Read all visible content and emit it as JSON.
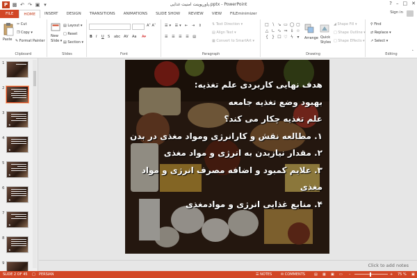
{
  "window": {
    "title": "پاورپوینت امنیت غذایی.pptx - PowerPoint",
    "sign_in": "Sign in",
    "controls": [
      "?",
      "–",
      "□",
      "✕"
    ]
  },
  "tabs": [
    "FILE",
    "HOME",
    "INSERT",
    "DESIGN",
    "TRANSITIONS",
    "ANIMATIONS",
    "SLIDE SHOW",
    "REVIEW",
    "VIEW",
    "FILEminimizer"
  ],
  "ribbon": {
    "clipboard": {
      "label": "Clipboard",
      "paste": "Paste",
      "cut": "Cut",
      "copy": "Copy",
      "format_painter": "Format Painter"
    },
    "slides": {
      "label": "Slides",
      "new_slide": "New",
      "new_slide_2": "Slide",
      "layout": "Layout",
      "reset": "Reset",
      "section": "Section"
    },
    "font": {
      "label": "Font",
      "bold": "B",
      "italic": "I",
      "underline": "U",
      "strike": "S",
      "shadow": "abc",
      "spacing": "AV",
      "case": "Aa"
    },
    "paragraph": {
      "label": "Paragraph",
      "text_direction": "Text Direction",
      "align_text": "Align Text",
      "convert_smartart": "Convert to SmartArt"
    },
    "drawing": {
      "label": "Drawing",
      "arrange": "Arrange",
      "quick_styles": "Quick",
      "quick_styles_2": "Styles",
      "shape_fill": "Shape Fill",
      "shape_outline": "Shape Outline",
      "shape_effects": "Shape Effects"
    },
    "editing": {
      "label": "Editing",
      "find": "Find",
      "replace": "Replace",
      "select": "Select"
    }
  },
  "thumbnails": [
    "1",
    "2",
    "3",
    "4",
    "5",
    "6",
    "7",
    "8",
    "9"
  ],
  "slide": {
    "lines": [
      "هدف نهایی کاربردی علم تغذیه:",
      "بهبود وضع تغذیه جامعه",
      "علم تغذیه چکار می کند؟",
      "۱. مطالعه نقش و کارانرژی ومواد مغذی در بدن",
      "۲. مقدار نیازبدن به انرژی و مواد مغذی",
      "۳. علایم کمبود و اضافه مصرف انرژی و مواد",
      "مغذی",
      "۴. منابع غذایی انرژی و موادمغذی"
    ]
  },
  "notes_placeholder": "Click to add notes",
  "status": {
    "slide_info": "SLIDE 2 OF 45",
    "language": "PERSIAN",
    "notes": "NOTES",
    "comments": "COMMENTS",
    "zoom": "75 %"
  },
  "colors": {
    "accent": "#d24726",
    "ribbon_bg": "#ffffff",
    "canvas_bg": "#e6e6e6"
  }
}
